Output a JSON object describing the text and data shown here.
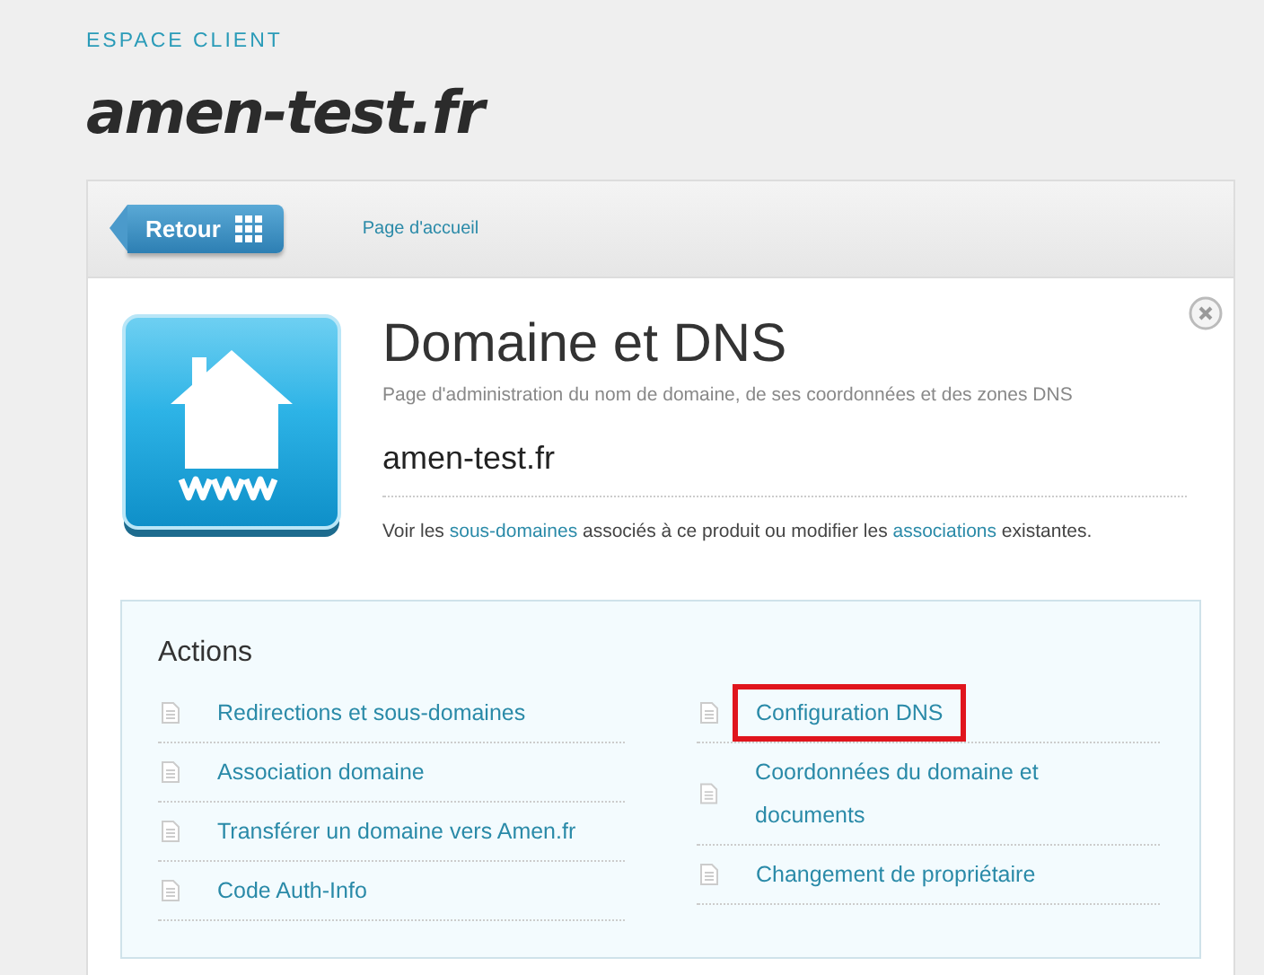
{
  "header": {
    "eyebrow": "ESPACE CLIENT",
    "title": "amen-test.fr"
  },
  "toolbar": {
    "back_button": "Retour",
    "home_link": "Page d'accueil"
  },
  "product": {
    "title": "Domaine et DNS",
    "subtitle": "Page d'administration du nom de domaine, de ses coordonnées et des zones DNS",
    "domain": "amen-test.fr",
    "description": [
      {
        "kind": "text",
        "text": "Voir les "
      },
      {
        "kind": "link",
        "text": "sous-domaines"
      },
      {
        "kind": "text",
        "text": " associés à ce produit ou modifier les "
      },
      {
        "kind": "link",
        "text": "associations"
      },
      {
        "kind": "text",
        "text": " existantes."
      }
    ]
  },
  "actions": {
    "title": "Actions",
    "columns": [
      [
        {
          "label": "Redirections et sous-domaines",
          "highlighted": false
        },
        {
          "label": "Association domaine",
          "highlighted": false
        },
        {
          "label": "Transférer un domaine vers Amen.fr",
          "highlighted": false
        },
        {
          "label": "Code Auth-Info",
          "highlighted": false
        }
      ],
      [
        {
          "label": "Configuration DNS",
          "highlighted": true
        },
        {
          "label": "Coordonnées du domaine et documents",
          "highlighted": false
        },
        {
          "label": "Changement de propriétaire",
          "highlighted": false
        }
      ]
    ]
  }
}
